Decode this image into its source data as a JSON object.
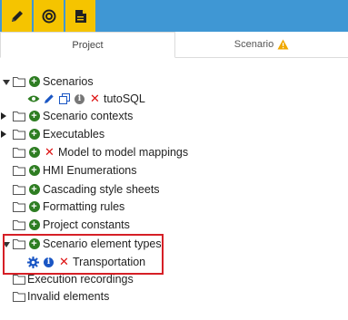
{
  "toolbar": {
    "buttons": [
      {
        "icon": "pencil-icon"
      },
      {
        "icon": "target-icon"
      },
      {
        "icon": "document-icon"
      }
    ],
    "accent": "#3f97d4",
    "active_color": "#f5c400"
  },
  "tabs": [
    {
      "label": "Project"
    },
    {
      "label": "Scenario",
      "icon": "warning-icon"
    }
  ],
  "tree": {
    "scenarios": {
      "label": "Scenarios",
      "child": {
        "label": "tutoSQL"
      }
    },
    "scenario_contexts": {
      "label": "Scenario contexts"
    },
    "executables": {
      "label": "Executables"
    },
    "model_mappings": {
      "label": "Model to model mappings"
    },
    "hmi_enumerations": {
      "label": "HMI Enumerations"
    },
    "css": {
      "label": "Cascading style sheets"
    },
    "formatting_rules": {
      "label": "Formatting rules"
    },
    "project_constants": {
      "label": "Project constants"
    },
    "scenario_element_types": {
      "label": "Scenario element types",
      "child": {
        "label": "Transportation"
      }
    },
    "execution_recordings": {
      "label": "Execution recordings"
    },
    "invalid_elements": {
      "label": "Invalid elements"
    }
  },
  "highlight_color": "#d61f26"
}
